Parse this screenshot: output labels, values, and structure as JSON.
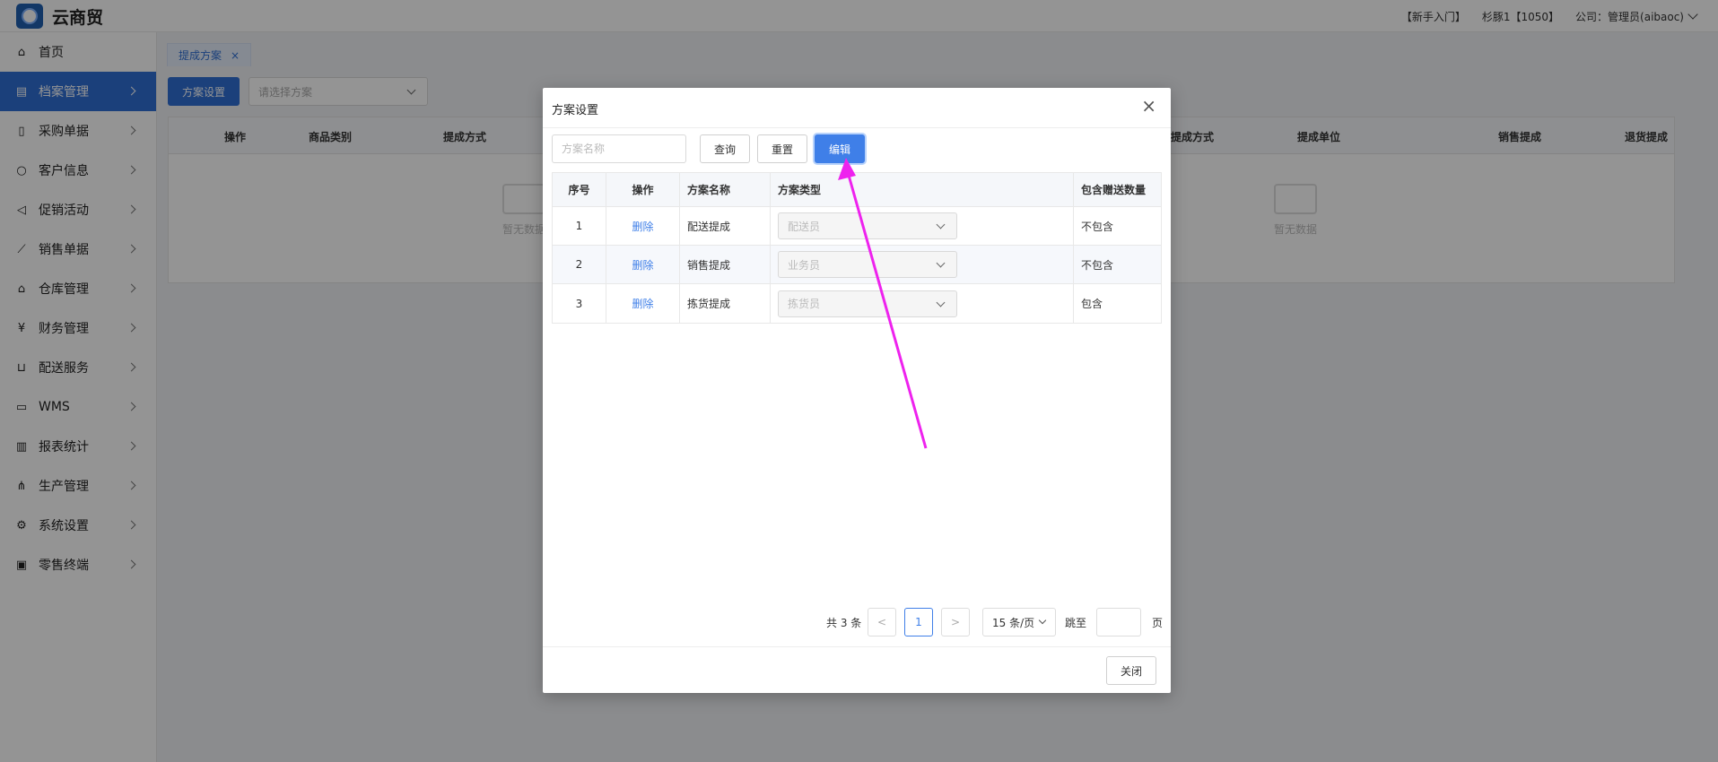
{
  "header": {
    "brand": "云商贸",
    "links": [
      "【新手入门】",
      "杉豚1【1050】",
      "公司：管理员(aibaoc)"
    ]
  },
  "sidebar": {
    "items": [
      {
        "label": "首页",
        "icon": "home-icon"
      },
      {
        "label": "档案管理",
        "icon": "archive-icon",
        "active": true
      },
      {
        "label": "采购单据",
        "icon": "document-icon"
      },
      {
        "label": "客户信息",
        "icon": "user-icon"
      },
      {
        "label": "促销活动",
        "icon": "megaphone-icon"
      },
      {
        "label": "销售单据",
        "icon": "line-chart-icon"
      },
      {
        "label": "仓库管理",
        "icon": "warehouse-icon"
      },
      {
        "label": "财务管理",
        "icon": "finance-icon"
      },
      {
        "label": "配送服务",
        "icon": "cart-icon"
      },
      {
        "label": "WMS",
        "icon": "truck-icon"
      },
      {
        "label": "报表统计",
        "icon": "bar-chart-icon"
      },
      {
        "label": "生产管理",
        "icon": "network-icon"
      },
      {
        "label": "系统设置",
        "icon": "gear-icon"
      },
      {
        "label": "零售终端",
        "icon": "bag-icon"
      }
    ]
  },
  "tabs": [
    {
      "label": "提成方案",
      "close": "×"
    }
  ],
  "toolbar": {
    "scheme_button": "方案设置",
    "scheme_select_placeholder": "请选择方案"
  },
  "bg_table": {
    "columns": [
      "操作",
      "商品类别",
      "提成方式",
      "提成方式",
      "提成单位",
      "销售提成",
      "退货提成"
    ],
    "empty_text": "暂无数据"
  },
  "dialog": {
    "title": "方案设置",
    "close_symbol": "×",
    "search_placeholder": "方案名称",
    "query_button": "查询",
    "reset_button": "重置",
    "edit_button": "编辑",
    "columns": [
      "序号",
      "操作",
      "方案名称",
      "方案类型",
      "包含赠送数量"
    ],
    "rows": [
      {
        "index": "1",
        "action": "删除",
        "name": "配送提成",
        "type": "配送员",
        "include_gift": "不包含"
      },
      {
        "index": "2",
        "action": "删除",
        "name": "销售提成",
        "type": "业务员",
        "include_gift": "不包含"
      },
      {
        "index": "3",
        "action": "删除",
        "name": "拣货提成",
        "type": "拣货员",
        "include_gift": "包含"
      }
    ],
    "pagination": {
      "total": "共 3 条",
      "prev": "<",
      "current": "1",
      "next": ">",
      "page_size": "15 条/页",
      "jump_label": "跳至",
      "page_unit": "页"
    },
    "footer_close": "关闭"
  },
  "colors": {
    "primary": "#2f6fd4",
    "annotation_arrow": "#ee22ee"
  }
}
